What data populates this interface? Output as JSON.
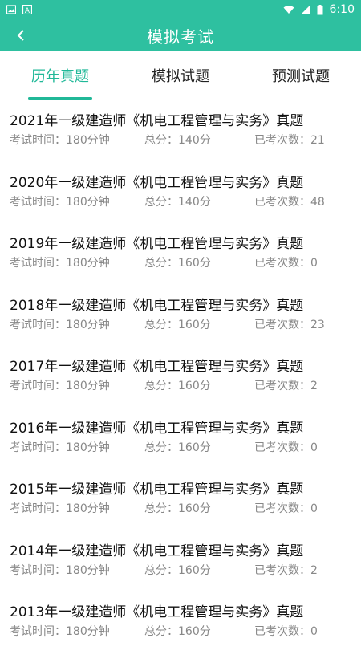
{
  "status": {
    "time": "6:10"
  },
  "header": {
    "title": "模拟考试"
  },
  "tabs": [
    {
      "label": "历年真题"
    },
    {
      "label": "模拟试题"
    },
    {
      "label": "预测试题"
    }
  ],
  "colors": {
    "accent": "#2ec0a0",
    "active_tab": "#20b898"
  },
  "items": [
    {
      "title": "2021年一级建造师《机电工程管理与实务》真题",
      "time": "考试时间：180分钟",
      "score": "总分：140分",
      "count": "已考次数：21"
    },
    {
      "title": "2020年一级建造师《机电工程管理与实务》真题",
      "time": "考试时间：180分钟",
      "score": "总分：140分",
      "count": "已考次数：48"
    },
    {
      "title": "2019年一级建造师《机电工程管理与实务》真题",
      "time": "考试时间：180分钟",
      "score": "总分：160分",
      "count": "已考次数：0"
    },
    {
      "title": "2018年一级建造师《机电工程管理与实务》真题",
      "time": "考试时间：180分钟",
      "score": "总分：160分",
      "count": "已考次数：23"
    },
    {
      "title": "2017年一级建造师《机电工程管理与实务》真题",
      "time": "考试时间：180分钟",
      "score": "总分：160分",
      "count": "已考次数：2"
    },
    {
      "title": "2016年一级建造师《机电工程管理与实务》真题",
      "time": "考试时间：180分钟",
      "score": "总分：160分",
      "count": "已考次数：0"
    },
    {
      "title": "2015年一级建造师《机电工程管理与实务》真题",
      "time": "考试时间：180分钟",
      "score": "总分：160分",
      "count": "已考次数：0"
    },
    {
      "title": "2014年一级建造师《机电工程管理与实务》真题",
      "time": "考试时间：180分钟",
      "score": "总分：160分",
      "count": "已考次数：2"
    },
    {
      "title": "2013年一级建造师《机电工程管理与实务》真题",
      "time": "考试时间：180分钟",
      "score": "总分：160分",
      "count": "已考次数：0"
    }
  ]
}
